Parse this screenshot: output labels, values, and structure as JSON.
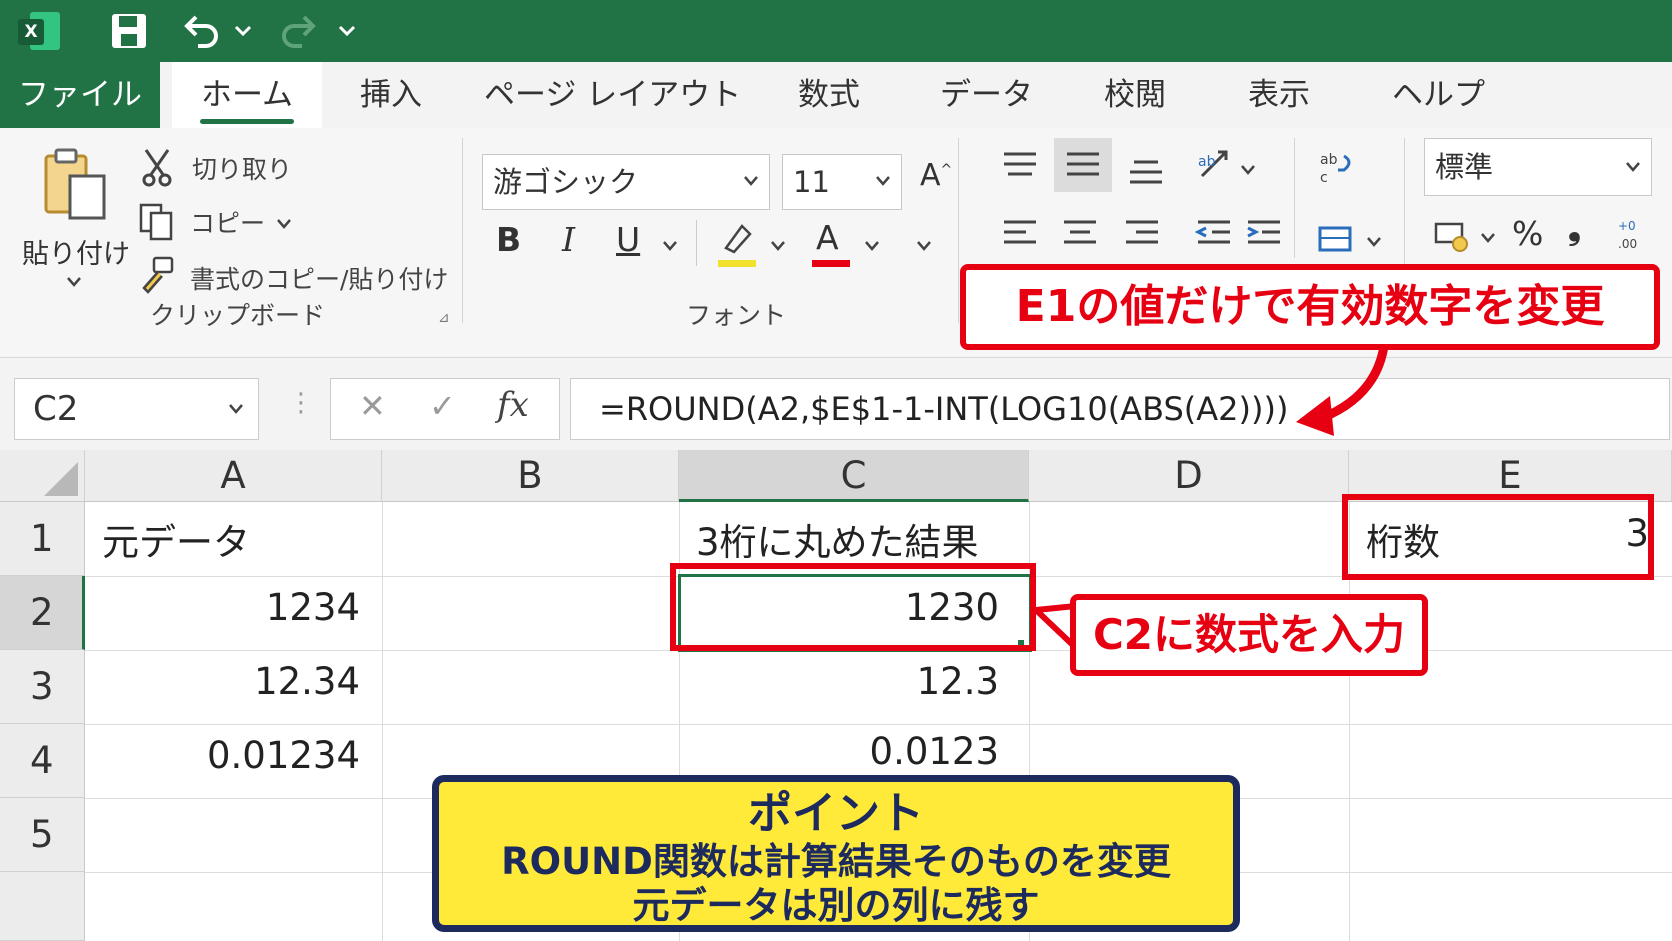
{
  "titlebar": {
    "app_icon": "excel-icon",
    "save_icon": "save-icon",
    "undo_icon": "undo-icon",
    "redo_icon": "redo-icon",
    "qat_more_icon": "chevron-down-icon"
  },
  "tabs": [
    {
      "label": "ファイル"
    },
    {
      "label": "ホーム"
    },
    {
      "label": "挿入"
    },
    {
      "label": "ページ レイアウト"
    },
    {
      "label": "数式"
    },
    {
      "label": "データ"
    },
    {
      "label": "校閲"
    },
    {
      "label": "表示"
    },
    {
      "label": "ヘルプ"
    }
  ],
  "clipboard": {
    "paste_label": "貼り付け",
    "cut_label": "切り取り",
    "copy_label": "コピー",
    "format_painter_label": "書式のコピー/貼り付け",
    "group_label": "クリップボード"
  },
  "font": {
    "font_name": "游ゴシック",
    "font_size": "11",
    "grow_label": "A",
    "bold_label": "B",
    "italic_label": "I",
    "underline_label": "U",
    "font_color_label": "A",
    "group_label": "フォント",
    "highlight_color": "#f2e12b",
    "font_color": "#e60012"
  },
  "number": {
    "format": "標準",
    "percent_label": "%",
    "comma_label": "❟"
  },
  "formula_bar": {
    "name_box": "C2",
    "cancel_label": "✕",
    "enter_label": "✓",
    "fx_label": "fx",
    "formula": "=ROUND(A2,$E$1-1-INT(LOG10(ABS(A2))))"
  },
  "grid": {
    "columns": [
      "A",
      "B",
      "C",
      "D",
      "E"
    ],
    "rows": [
      "1",
      "2",
      "3",
      "4",
      "5"
    ],
    "a1": "元データ",
    "a2": "1234",
    "a3": "12.34",
    "a4": "0.01234",
    "c1": "3桁に丸めた結果",
    "c2": "1230",
    "c3": "12.3",
    "c4": "0.0123",
    "e1_label": "桁数",
    "e1_value": "3"
  },
  "callouts": {
    "e1_note": "E1の値だけで有効数字を変更",
    "c2_note": "C2に数式を入力",
    "point_title": "ポイント",
    "point_line1": "ROUND関数は計算結果そのものを変更",
    "point_line2": "元データは別の列に残す"
  },
  "colors": {
    "excel_green": "#217346",
    "callout_red": "#e60012",
    "point_yellow": "#ffea3a",
    "point_navy": "#1c2a5e"
  }
}
